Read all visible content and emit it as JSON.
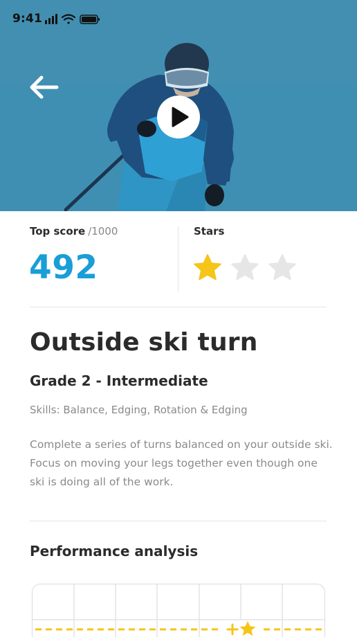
{
  "status_bar": {
    "time": "9:41"
  },
  "hero": {
    "back_icon": "arrow-left-icon",
    "play_icon": "play-icon",
    "colors": {
      "sky": "#3f8fb3",
      "jacket": "#2c8ab8"
    }
  },
  "scores": {
    "top_score_label": "Top score",
    "top_score_max": "/1000",
    "top_score_value": "492",
    "stars_label": "Stars",
    "stars_earned": 1,
    "stars_total": 3,
    "colors": {
      "score": "#1a9ed8",
      "star_on": "#f5c518",
      "star_off": "#e6e6e6"
    }
  },
  "lesson": {
    "title": "Outside ski turn",
    "grade": "Grade 2 - Intermediate",
    "skills": "Skills: Balance, Edging, Rotation & Edging",
    "description": "Complete a series of turns balanced on your outside ski. Focus on moving your legs together even though one ski is doing all of the work."
  },
  "performance": {
    "title": "Performance analysis",
    "marker_icons": [
      "plus-icon",
      "star-icon"
    ],
    "colors": {
      "target_line": "#f5c518",
      "grid": "#e4e4e4"
    }
  }
}
